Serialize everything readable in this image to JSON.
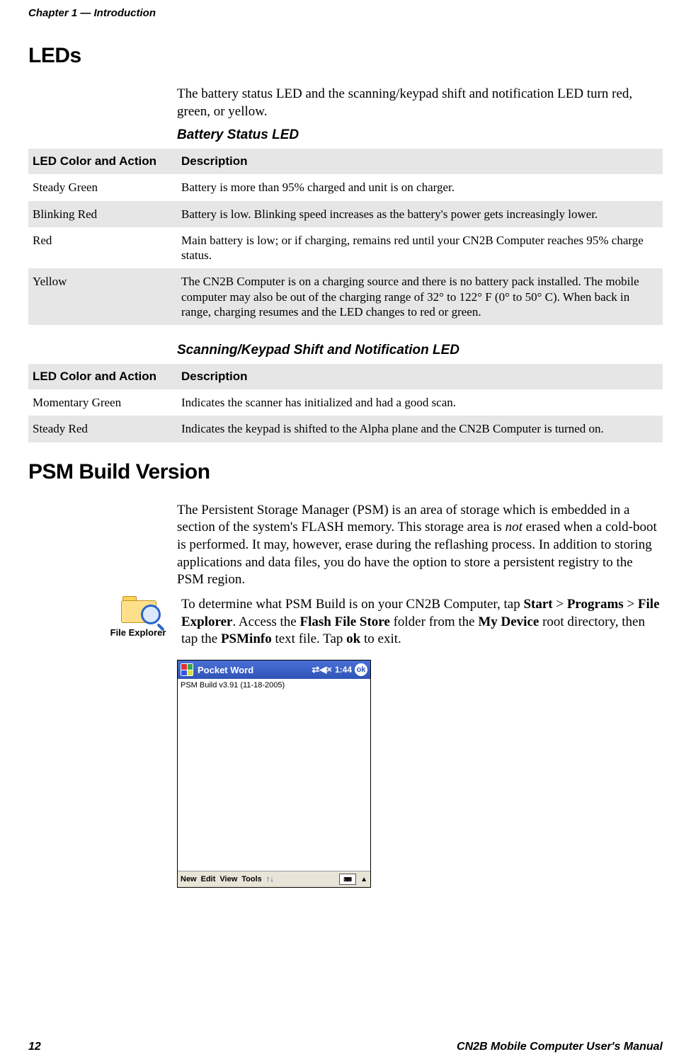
{
  "header": "Chapter 1 — Introduction",
  "sec1_title": "LEDs",
  "sec1_intro": "The battery status LED and the scanning/keypad shift and notification LED turn red, green, or yellow.",
  "table1": {
    "heading": "Battery Status LED",
    "col1": "LED Color and Action",
    "col2": "Description",
    "rows": [
      {
        "c1": "Steady Green",
        "c2": "Battery is more than 95% charged and unit is on charger."
      },
      {
        "c1": "Blinking Red",
        "c2": "Battery is low. Blinking speed increases as the battery's power gets increasingly lower."
      },
      {
        "c1": "Red",
        "c2": "Main battery is low; or if charging, remains red until your CN2B Computer reaches 95% charge status."
      },
      {
        "c1": "Yellow",
        "c2": "The CN2B Computer is on a charging source and there is no battery pack installed. The mobile computer may also be out of the charging range of 32° to 122° F (0° to 50° C). When back in range, charging resumes and the LED changes to red or green."
      }
    ]
  },
  "table2": {
    "heading": "Scanning/Keypad Shift and Notification LED",
    "col1": "LED Color and Action",
    "col2": "Description",
    "rows": [
      {
        "c1": "Momentary Green",
        "c2": "Indicates the scanner has initialized and had a good scan."
      },
      {
        "c1": "Steady Red",
        "c2": "Indicates the keypad is shifted to the Alpha plane and the CN2B Computer is turned on."
      }
    ]
  },
  "sec2_title": "PSM Build Version",
  "psm_p1_a": "The Persistent Storage Manager (PSM) is an area of storage which is embedded in a section of the system's FLASH memory. This storage area is ",
  "psm_p1_not": "not",
  "psm_p1_b": " erased when a cold-boot is performed. It may, however, erase during the reflashing process. In addition to storing applications and data files, you do have the option to store a persistent registry to the PSM region.",
  "psm_p2_a": "To determine what PSM Build is on your CN2B Computer, tap ",
  "psm_p2_start": "Start",
  "psm_p2_sep1": " > ",
  "psm_p2_programs": "Programs",
  "psm_p2_sep2": " > ",
  "psm_p2_fileexp": "File Explorer",
  "psm_p2_b": ". Access the ",
  "psm_p2_ffs": "Flash File Store",
  "psm_p2_c": " folder from the ",
  "psm_p2_mydev": "My Device",
  "psm_p2_d": " root directory, then tap the ",
  "psm_p2_psminfo": "PSMinfo",
  "psm_p2_e": " text file. Tap ",
  "psm_p2_ok": "ok",
  "psm_p2_f": " to exit.",
  "icon_label": "File Explorer",
  "ss": {
    "title": "Pocket Word",
    "clock": "1:44",
    "ok": "ok",
    "content": "PSM Build v3.91 (11-18-2005)",
    "menu": [
      "New",
      "Edit",
      "View",
      "Tools"
    ]
  },
  "footer": {
    "page": "12",
    "doc": "CN2B Mobile Computer User's Manual"
  }
}
